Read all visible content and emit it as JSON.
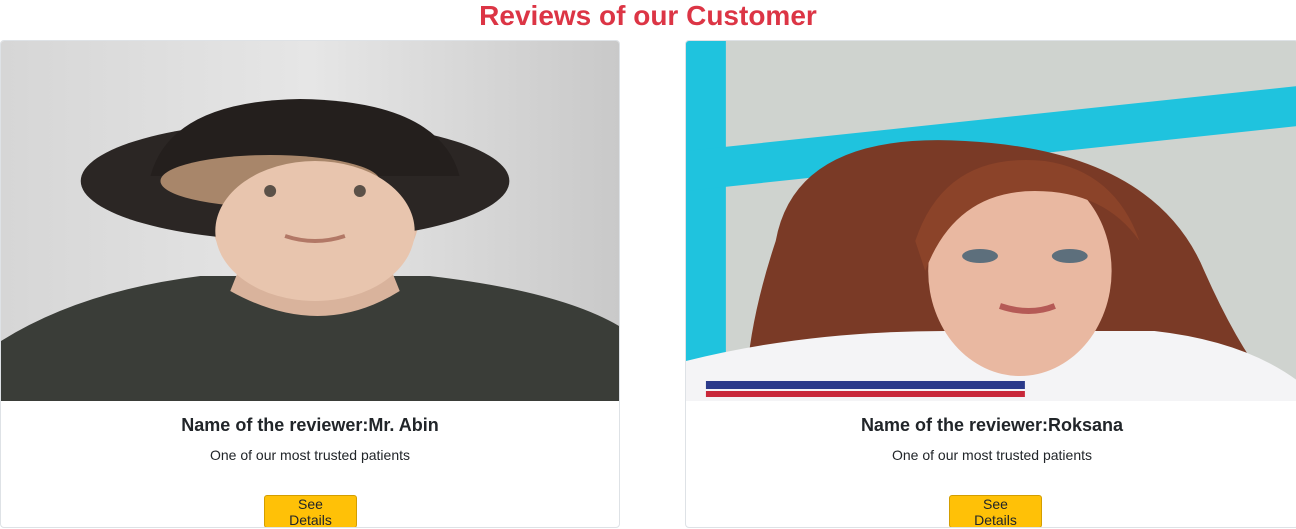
{
  "section": {
    "title": "Reviews of our Customer"
  },
  "reviews": [
    {
      "name": "Name of the reviewer:Mr. Abin",
      "description": "One of our most trusted patients",
      "button_label": "See Details"
    },
    {
      "name": "Name of the reviewer:Roksana",
      "description": "One of our most trusted patients",
      "button_label": "See Details"
    }
  ],
  "colors": {
    "title": "#dc3545",
    "button": "#ffc107"
  }
}
